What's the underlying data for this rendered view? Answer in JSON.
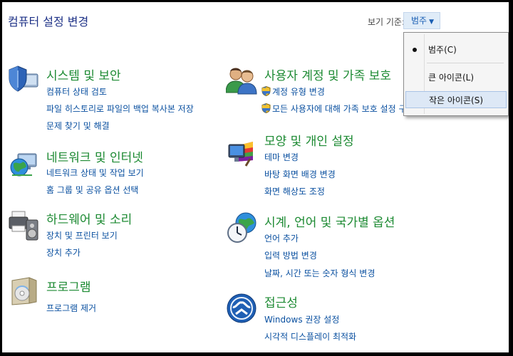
{
  "header": {
    "title": "컴퓨터 설정 변경",
    "view_by_label": "보기 기준:",
    "view_by_value": "범주"
  },
  "view_menu": {
    "items": [
      {
        "label": "범주(C)",
        "checked": true
      },
      {
        "label": "큰 아이콘(L)"
      },
      {
        "label": "작은 아이콘(S)",
        "highlighted": true
      }
    ]
  },
  "categories": {
    "system": {
      "title": "시스템 및 보안",
      "icon": "shield-computer-icon",
      "links": [
        "컴퓨터 상태 검토",
        "파일 히스토리로 파일의 백업 복사본 저장",
        "문제 찾기 및 해결"
      ]
    },
    "network": {
      "title": "네트워크 및 인터넷",
      "icon": "network-globe-icon",
      "links": [
        "네트워크 상태 및 작업 보기",
        "홈 그룹 및 공유 옵션 선택"
      ]
    },
    "hardware": {
      "title": "하드웨어 및 소리",
      "icon": "printer-speaker-icon",
      "links": [
        "장치 및 프린터 보기",
        "장치 추가"
      ]
    },
    "programs": {
      "title": "프로그램",
      "icon": "program-box-icon",
      "links": [
        "프로그램 제거"
      ]
    },
    "users": {
      "title": "사용자 계정 및 가족 보호",
      "icon": "users-icon",
      "links": [
        "계정 유형 변경",
        "모든 사용자에 대해 가족 보호 설정 구성"
      ]
    },
    "appearance": {
      "title": "모양 및 개인 설정",
      "icon": "monitor-palette-icon",
      "links": [
        "테마 변경",
        "바탕 화면 배경 변경",
        "화면 해상도 조정"
      ]
    },
    "clock": {
      "title": "시계, 언어 및 국가별 옵션",
      "icon": "clock-globe-icon",
      "links": [
        "언어 추가",
        "입력 방법 변경",
        "날짜, 시간 또는 숫자 형식 변경"
      ]
    },
    "ease": {
      "title": "접근성",
      "icon": "ease-of-access-icon",
      "links": [
        "Windows 권장 설정",
        "시각적 디스플레이 최적화"
      ]
    }
  }
}
